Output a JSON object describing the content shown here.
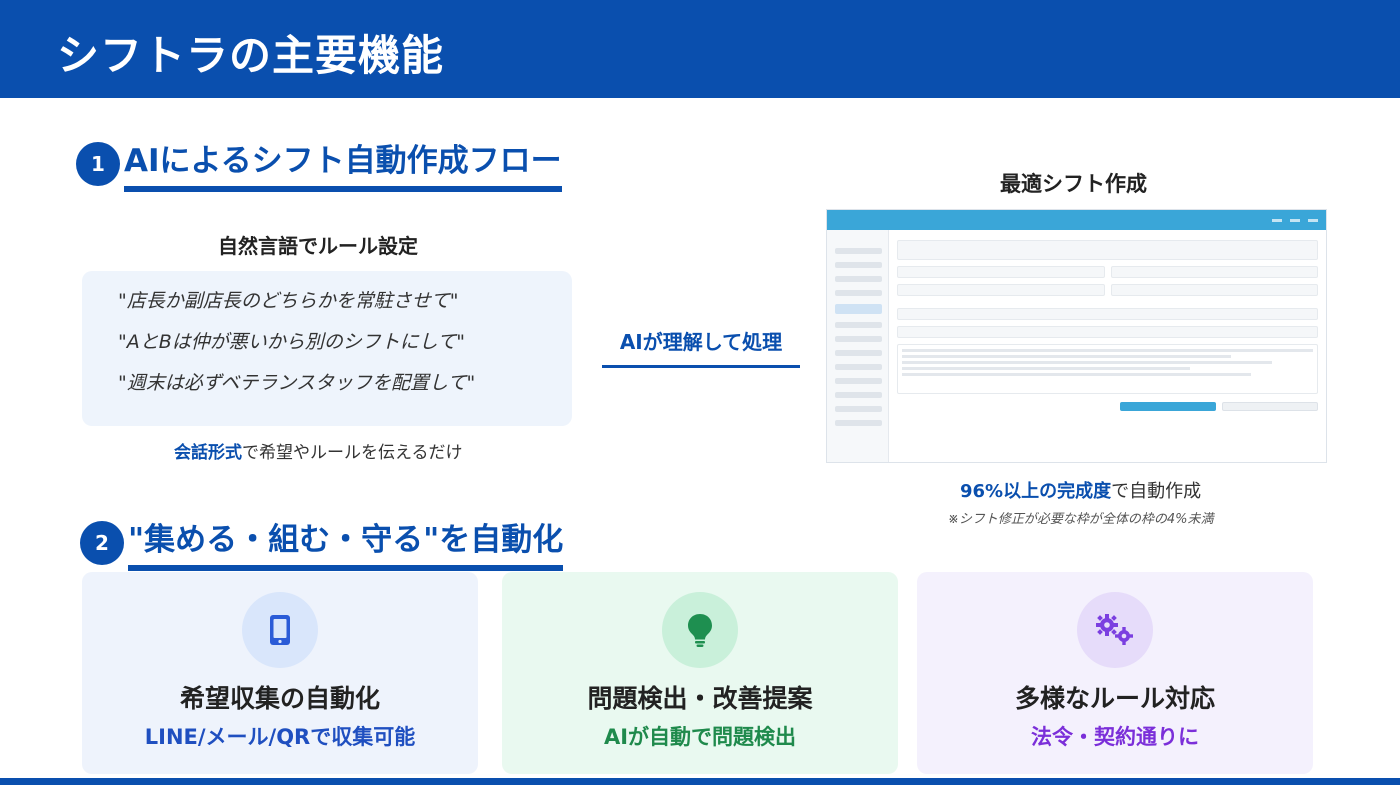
{
  "header": {
    "title": "シフトラの主要機能"
  },
  "section1": {
    "number": "1",
    "title": "AIによるシフト自動作成フロー",
    "left_subtitle": "自然言語でルール設定",
    "quotes": [
      "\"店長か副店長のどちらかを常駐させて\"",
      "\"AとBは仲が悪いから別のシフトにして\"",
      "\"週末は必ずベテランスタッフを配置して\""
    ],
    "caption_accent": "会話形式",
    "caption_rest": "で希望やルールを伝えるだけ",
    "arrow_label": "AIが理解して処理",
    "right_subtitle": "最適シフト作成",
    "result_accent": "96%以上の完成度",
    "result_rest": "で自動作成",
    "result_note": "※シフト修正が必要な枠が全体の枠の4%未満"
  },
  "section2": {
    "number": "2",
    "title": "\"集める・組む・守る\"を自動化",
    "cards": [
      {
        "title": "希望収集の自動化",
        "subtitle": "LINE/メール/QRで収集可能",
        "icon": "smartphone-icon",
        "color": "#1f4fc0"
      },
      {
        "title": "問題検出・改善提案",
        "subtitle": "AIが自動で問題検出",
        "icon": "lightbulb-icon",
        "color": "#1f8a4c"
      },
      {
        "title": "多様なルール対応",
        "subtitle": "法令・契約通りに",
        "icon": "gears-icon",
        "color": "#7b2fd9"
      }
    ]
  },
  "colors": {
    "brand": "#0a4fae"
  }
}
